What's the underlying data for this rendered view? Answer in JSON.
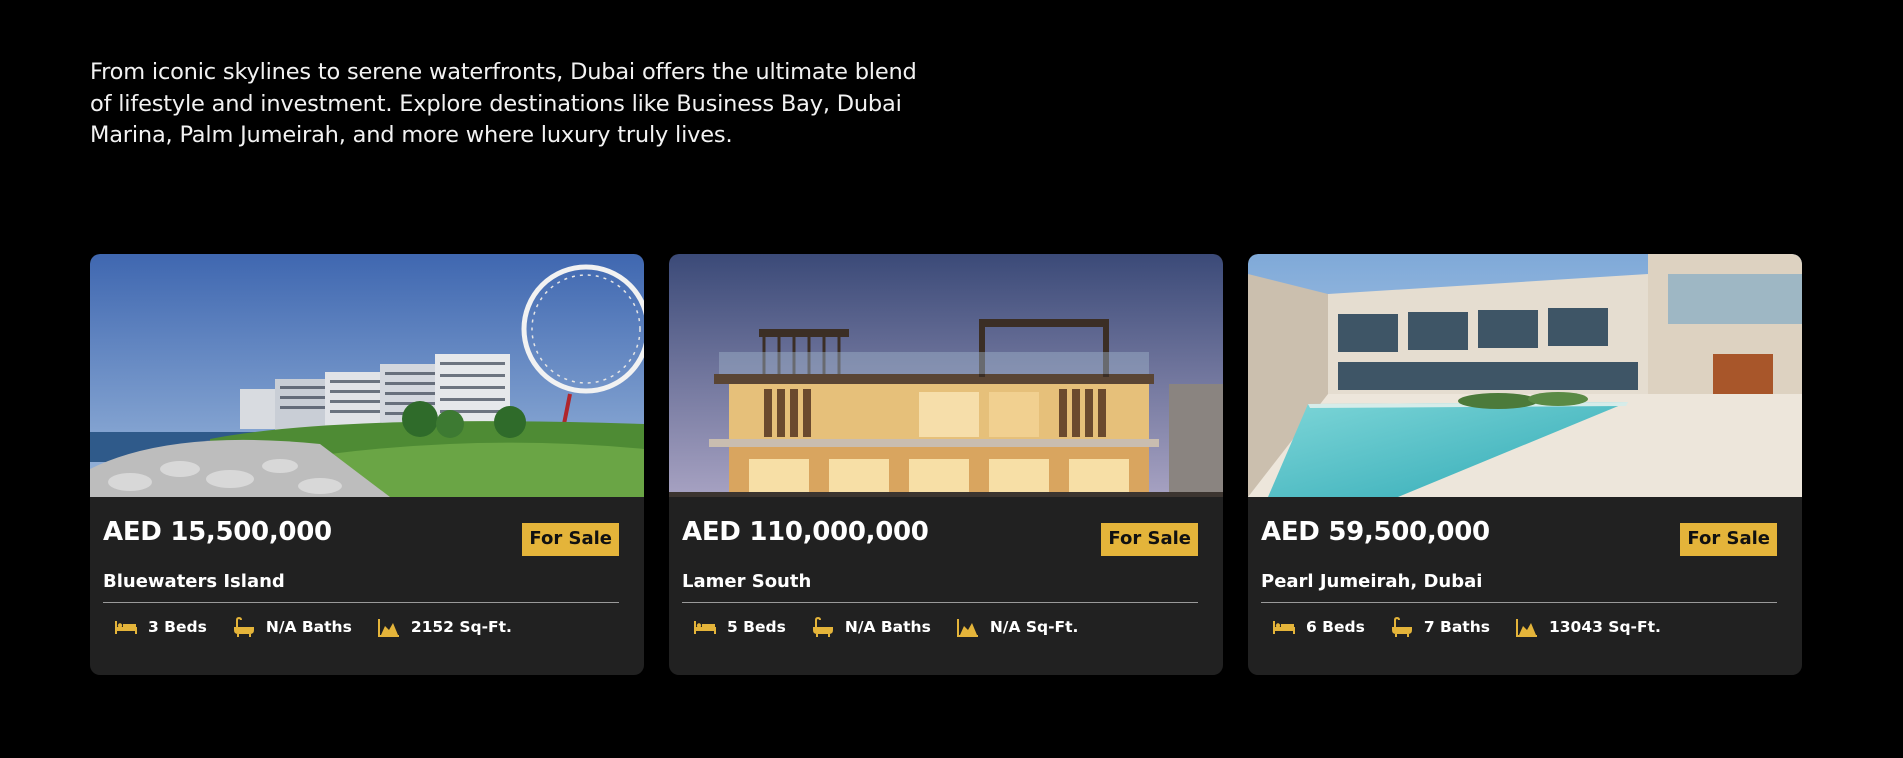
{
  "intro": {
    "line1": "From iconic skylines to serene waterfronts, Dubai offers the ultimate blend",
    "line2": "of lifestyle and investment. Explore destinations like Business Bay, Dubai",
    "line3": "Marina, Palm Jumeirah, and more where luxury truly lives."
  },
  "theme": {
    "background": "#000000",
    "card_background": "#212121",
    "accent": "#e4b43a"
  },
  "listings": [
    {
      "price": "AED 15,500,000",
      "status": "For Sale",
      "location": "Bluewaters Island",
      "beds": "3 Beds",
      "baths": "N/A Baths",
      "area": "2152 Sq-Ft.",
      "photo": "waterfront-towers-ferris-wheel"
    },
    {
      "price": "AED 110,000,000",
      "status": "For Sale",
      "location": "Lamer South",
      "beds": "5 Beds",
      "baths": "N/A Baths",
      "area": "N/A Sq-Ft.",
      "photo": "modern-villa-dusk"
    },
    {
      "price": "AED 59,500,000",
      "status": "For Sale",
      "location": "Pearl Jumeirah, Dubai",
      "beds": "6 Beds",
      "baths": "7 Baths",
      "area": "13043 Sq-Ft.",
      "photo": "villa-with-pool"
    }
  ],
  "icons": {
    "beds": "bed-icon",
    "baths": "bathtub-icon",
    "area": "area-icon"
  }
}
